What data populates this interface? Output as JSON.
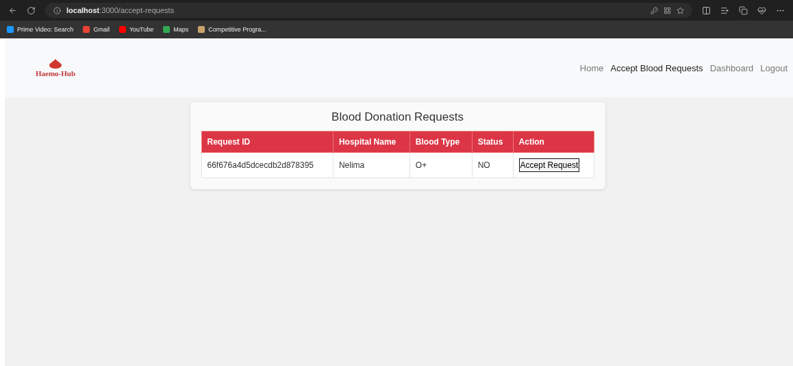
{
  "browser": {
    "url_host": "localhost",
    "url_path": ":3000/accept-requests",
    "bookmarks": [
      {
        "label": "Prime Video: Search",
        "color": "#1a98ff"
      },
      {
        "label": "Gmail",
        "color": "#ea4335"
      },
      {
        "label": "YouTube",
        "color": "#ff0000"
      },
      {
        "label": "Maps",
        "color": "#34a853"
      },
      {
        "label": "Competitive Progra...",
        "color": "#c9a46a"
      }
    ]
  },
  "header": {
    "logo": "Haemo-Hub",
    "nav": [
      {
        "label": "Home",
        "selected": false
      },
      {
        "label": "Accept Blood Requests",
        "selected": true
      },
      {
        "label": "Dashboard",
        "selected": false
      },
      {
        "label": "Logout",
        "selected": false
      }
    ]
  },
  "card": {
    "title": "Blood Donation Requests",
    "table": {
      "columns": [
        "Request ID",
        "Hospital Name",
        "Blood Type",
        "Status",
        "Action"
      ],
      "rows": [
        {
          "request_id": "66f676a4d5dcecdb2d878395",
          "hospital_name": "Nelima",
          "blood_type": "O+",
          "status": "NO",
          "action": "Accept Request"
        }
      ]
    }
  }
}
